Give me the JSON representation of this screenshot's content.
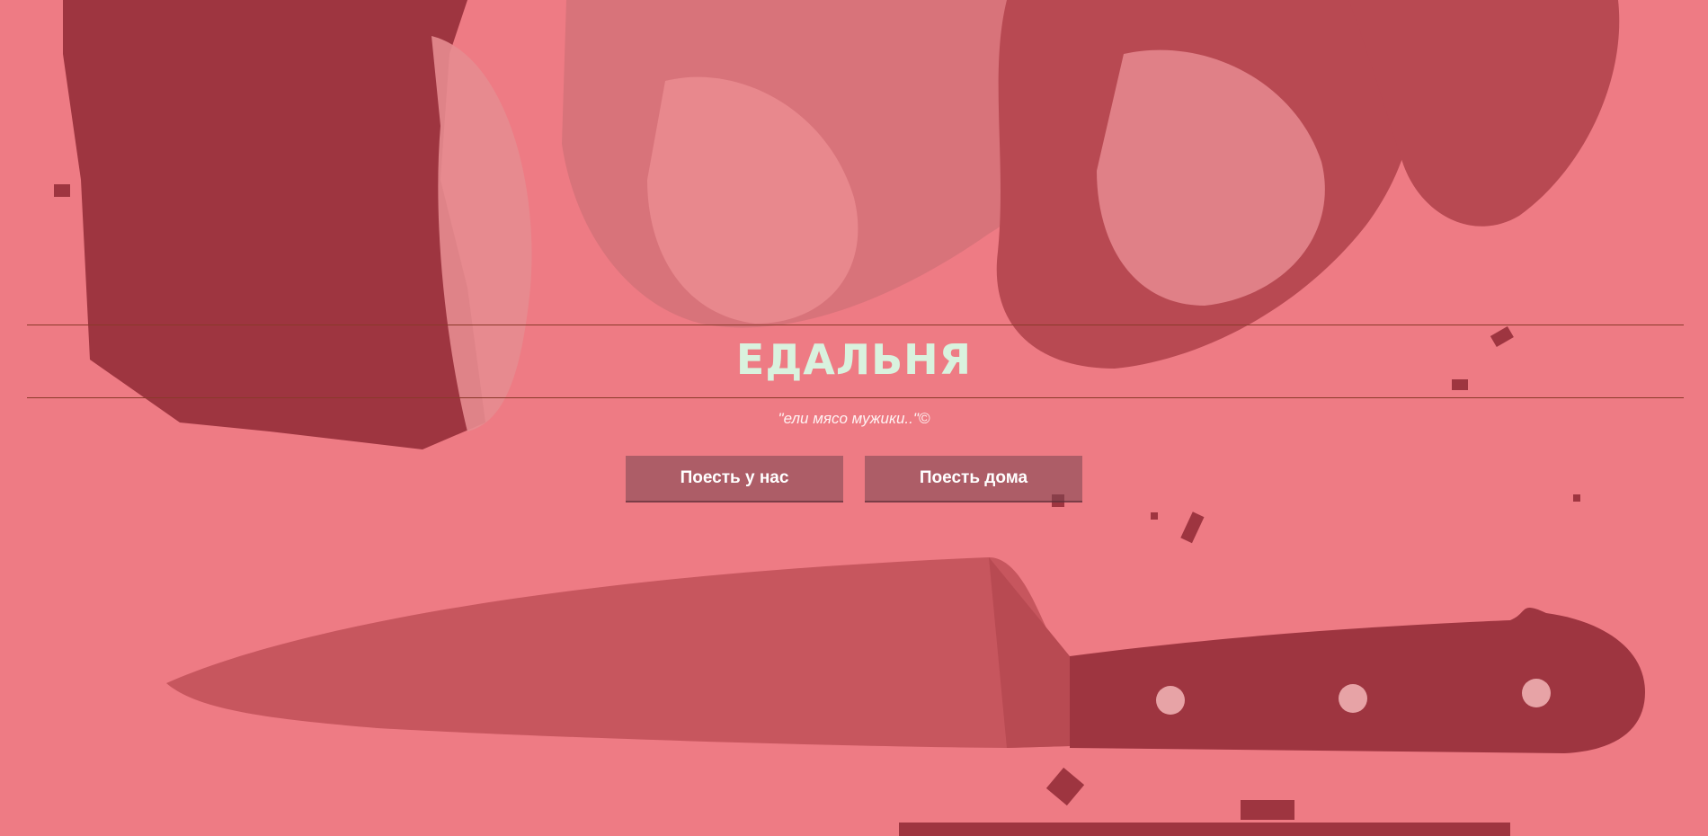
{
  "site": {
    "title": "ЕДАЛЬНЯ",
    "tagline": "\"ели мясо мужики..\"©"
  },
  "buttons": {
    "eat_here": "Поесть у нас",
    "eat_home": "Поесть дома"
  },
  "colors": {
    "overlay": "#ee7b84",
    "meat_dark": "#9e3540",
    "title": "#d9f2de"
  }
}
